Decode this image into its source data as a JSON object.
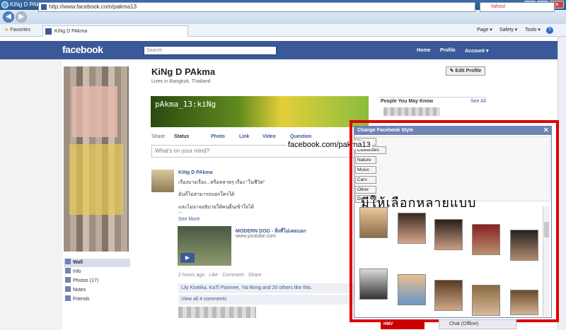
{
  "window": {
    "title": "KiNg D PAkma - Windows Internet Explorer",
    "controls": [
      "_",
      "□",
      "✕"
    ]
  },
  "browser": {
    "url": "http://www.facebook.com/pakma13",
    "search_placeholder": "Yahoo!",
    "favorites_label": "Favorites",
    "tab_title": "KiNg D PAkma",
    "tools": {
      "page": "Page ▾",
      "safety": "Safety ▾",
      "tools": "Tools ▾",
      "help": "?"
    }
  },
  "fb": {
    "logo": "facebook",
    "search_placeholder": "Search",
    "nav": {
      "home": "Home",
      "profile": "Profile",
      "account": "Account ▾"
    }
  },
  "profile": {
    "name": "KiNg D PAkma",
    "lives_in": "Lives in Bangkok, Thailand",
    "edit_label": "✎ Edit Profile",
    "banner_text": "pAkma_13:kiNg"
  },
  "left_nav": [
    {
      "label": "Wall",
      "icon": "wall-icon"
    },
    {
      "label": "Info",
      "icon": "info-icon"
    },
    {
      "label": "Photos (17)",
      "icon": "photos-icon"
    },
    {
      "label": "Notes",
      "icon": "notes-icon"
    },
    {
      "label": "Friends",
      "icon": "friends-icon"
    }
  ],
  "share": {
    "label": "Share:",
    "status": "Status",
    "photo": "Photo",
    "link": "Link",
    "video": "Video",
    "question": "Question",
    "placeholder": "What's on your mind?"
  },
  "post": {
    "author": "KiNg D PAkma",
    "lines": [
      "เรื่องบางเรื่อง...หรือหลายๆ เรื่อง \"ในชีวิต\"",
      "มันก็ไม่สามารถบอกใครได้",
      "และไม่อาจอธิบายให้คนอื่นเข้าใจได้",
      "..."
    ],
    "see_more": "See More",
    "video_title": "MODERN DOG - สิ่งที่ไม่เคยบอก",
    "video_url": "www.youtube.com",
    "time": "2 hours ago · Like · Comment · Share",
    "likes": "Lily Kiratika, KaTi Paninee, Yai Bong and 20 others like this.",
    "comments": "View all 4 comments"
  },
  "sidebar": {
    "pymk": "People You May Know",
    "see_all": "See All"
  },
  "style_panel": {
    "title": "Change Facebook Style",
    "close": "✕",
    "categories": [
      "New",
      "Celebrities",
      "Nature",
      "Music",
      "Cars",
      "Other",
      "Def"
    ],
    "thai_caption": "มีให้เลือกหลายแบบ",
    "overlay_text": "facebook.com/pakma13"
  },
  "chat": {
    "label": "Chat (Offline)"
  },
  "ad": {
    "label": "HMV"
  }
}
